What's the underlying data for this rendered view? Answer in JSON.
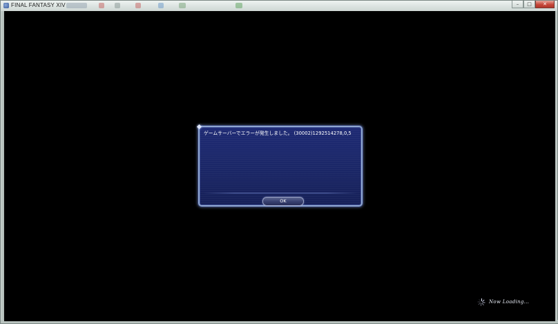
{
  "window": {
    "title": "FINAL FANTASY XIV",
    "minimize_glyph": "–",
    "maximize_glyph": "□",
    "close_glyph": "✕"
  },
  "dialog": {
    "message": "ゲームサーバーでエラーが発生しました。 (30002)1292514278,0,5",
    "ok_label": "OK"
  },
  "status": {
    "loading_text": "Now  Loading..."
  },
  "colors": {
    "dialog_bg": "#1b2768",
    "dialog_border": "#8fa6d0",
    "client_bg": "#000000"
  },
  "icons": {
    "app": "app-icon",
    "loading": "loading-spinner-icon"
  }
}
